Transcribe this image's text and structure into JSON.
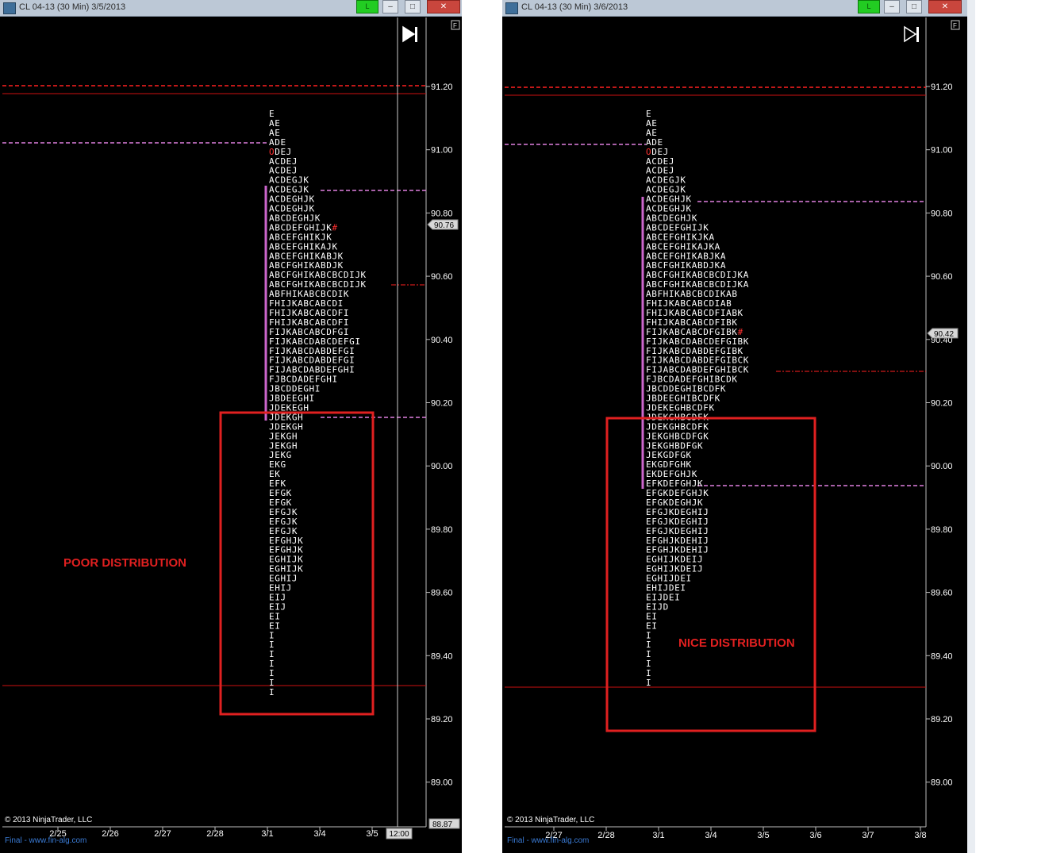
{
  "panels": [
    {
      "title": "CL 04-13 (30 Min)  3/5/2013",
      "l_label": "L",
      "f_label": "F",
      "price_ticks": [
        "91.20",
        "91.00",
        "90.80",
        "90.60",
        "90.40",
        "90.20",
        "90.00",
        "89.80",
        "89.60",
        "89.40",
        "89.20",
        "89.00"
      ],
      "price_marker": "90.76",
      "bottom_marker": "88.87",
      "date_labels": [
        "2/25",
        "2/26",
        "2/27",
        "2/28",
        "3/1",
        "3/4",
        "3/5"
      ],
      "time_marker": "12:00",
      "copyright": "© 2013 NinjaTrader, LLC",
      "footer": "Final - www.fin-alg.com",
      "annotation": "POOR DISTRIBUTION",
      "profile": [
        "E",
        "AE",
        "AE",
        "ADE",
        "ODEJ",
        "ACDEJ",
        "ACDEJ",
        "ACDEGJK",
        "ACDEGJK",
        "ACDEGHJK",
        "ACDEGHJK",
        "ABCDEGHJK",
        "ABCDEFGHIJK#",
        "ABCEFGHIKJK",
        "ABCEFGHIKAJK",
        "ABCEFGHIKABJK",
        "ABCFGHIKABDJK",
        "ABCFGHIKABCBCDIJK",
        "ABCFGHIKABCBCDIJK",
        "ABFHIKABCBCDIK",
        "FHIJKABCABCDI",
        "FHIJKABCABCDFI",
        "FHIJKABCABCDFI",
        "FIJKABCABCDFGI",
        "FIJKABCDABCDEFGI",
        "FIJKABCDABDEFGI",
        "FIJKABCDABDEFGI",
        "FIJABCDABDEFGHI",
        "FJBCDADEFGHI",
        "JBCDDEGHI",
        "JBDEEGHI",
        "JDEKEGH",
        "JDEKGH",
        "JDEKGH",
        "JEKGH",
        "JEKGH",
        "JEKG",
        "EKG",
        "EK",
        "EFK",
        "EFGK",
        "EFGK",
        "EFGJK",
        "EFGJK",
        "EFGJK",
        "EFGHJK",
        "EFGHJK",
        "EGHIJK",
        "EGHIJK",
        "EGHIJ",
        "EHIJ",
        "EIJ",
        "EIJ",
        "EI",
        "EI",
        "I",
        "I",
        "I",
        "I",
        "I",
        "I",
        "I"
      ]
    },
    {
      "title": "CL 04-13 (30 Min)  3/6/2013",
      "l_label": "L",
      "f_label": "F",
      "price_ticks": [
        "91.20",
        "91.00",
        "90.80",
        "90.60",
        "90.40",
        "90.20",
        "90.00",
        "89.80",
        "89.60",
        "89.40",
        "89.20",
        "89.00"
      ],
      "price_marker": "90.42",
      "date_labels": [
        "2/27",
        "2/28",
        "3/1",
        "3/4",
        "3/5",
        "3/6",
        "3/7",
        "3/8"
      ],
      "copyright": "© 2013 NinjaTrader, LLC",
      "footer": "Final - www.fin-alg.com",
      "annotation": "NICE DISTRIBUTION",
      "profile": [
        "E",
        "AE",
        "AE",
        "ADE",
        "ODEJ",
        "ACDEJ",
        "ACDEJ",
        "ACDEGJK",
        "ACDEGJK",
        "ACDEGHJK",
        "ACDEGHJK",
        "ABCDEGHJK",
        "ABCDEFGHIJK",
        "ABCEFGHIKJKA",
        "ABCEFGHIKAJKA",
        "ABCEFGHIKABJKA",
        "ABCFGHIKABDJKA",
        "ABCFGHIKABCBCDIJKA",
        "ABCFGHIKABCBCDIJKA",
        "ABFHIKABCBCDIKAB",
        "FHIJKABCABCDIAB",
        "FHIJKABCABCDFIABK",
        "FHIJKABCABCDFIBK",
        "FIJKABCABCDFGIBK#",
        "FIJKABCDABCDEFGIBK",
        "FIJKABCDABDEFGIBK",
        "FIJKABCDABDEFGIBCK",
        "FIJABCDABDEFGHIBCK",
        "FJBCDADEFGHIBCDK",
        "JBCDDEGHIBCDFK",
        "JBDEEGHIBCDFK",
        "JDEKEGHBCDFK",
        "JDEKGHBCDFK",
        "JDEKGHBCDFK",
        "JEKGHBCDFGK",
        "JEKGHBDFGK",
        "JEKGDFGK",
        "EKGDFGHK",
        "EKDEFGHJK",
        "EFKDEFGHJK",
        "EFGKDEFGHJK",
        "EFGKDEGHJK",
        "EFGJKDEGHIJ",
        "EFGJKDEGHIJ",
        "EFGJKDEGHIJ",
        "EFGHJKDEHIJ",
        "EFGHJKDEHIJ",
        "EGHIJKDEIJ",
        "EGHIJKDEIJ",
        "EGHIJDEI",
        "EHIJDEI",
        "EIJDEI",
        "EIJD",
        "EI",
        "EI",
        "I",
        "I",
        "I",
        "I",
        "I",
        "I"
      ]
    }
  ],
  "colors": {
    "background": "#000000",
    "annotation": "#e02020",
    "box": "#e02020",
    "value_area_bar": "#cc66cc",
    "dashed_pink": "#e080e0",
    "red_dashed": "#ff2020",
    "red_line": "#cc1010",
    "profile_text": "#ffffff",
    "axis_text": "#ffffff"
  }
}
